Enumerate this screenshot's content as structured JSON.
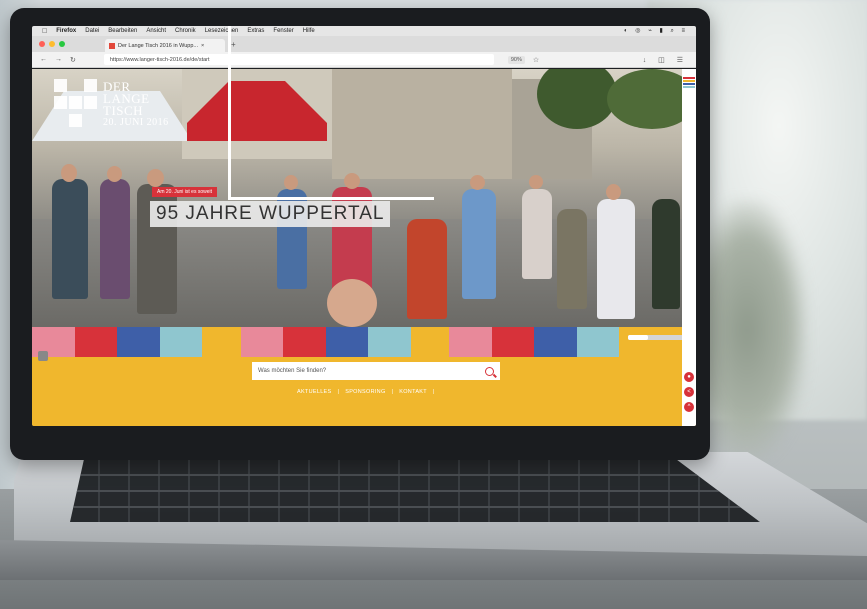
{
  "menubar": {
    "app_name": "Firefox",
    "items": [
      "Datei",
      "Bearbeiten",
      "Ansicht",
      "Chronik",
      "Lesezeichen",
      "Extras",
      "Fenster",
      "Hilfe"
    ]
  },
  "browser": {
    "tab_title": "Der Lange Tisch 2016 in Wupp...",
    "url": "https://www.langer-tisch-2016.de/de/start",
    "zoom": "90%"
  },
  "page": {
    "logo": {
      "line1": "DER",
      "line2": "LANGE",
      "line3": "TISCH",
      "date": "20. JUNI 2016"
    },
    "date_tag": "Am 20. Juni ist es soweit",
    "headline": "95 JAHRE WUPPERTAL",
    "search_placeholder": "Was möchten Sie finden?",
    "footer_nav": [
      "AKTUELLES",
      "|",
      "SPONSORING",
      "|",
      "KONTAKT",
      "|"
    ]
  },
  "colors": {
    "brand_yellow": "#f0b72d",
    "brand_red": "#d7323a",
    "stripe": [
      "#e8899a",
      "#d7323a",
      "#3e5fa8",
      "#8fc6cf",
      "#f0b72d",
      "#e8899a",
      "#d7323a",
      "#3e5fa8",
      "#8fc6cf",
      "#f0b72d",
      "#e8899a",
      "#d7323a",
      "#3e5fa8",
      "#8fc6cf"
    ]
  }
}
